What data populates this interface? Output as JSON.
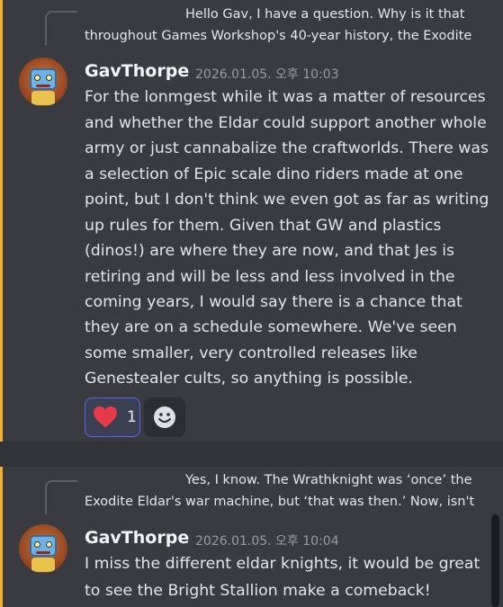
{
  "messages": [
    {
      "reply_preview": {
        "line1": "Hello Gav, I have a question. Why is it that",
        "line2": "throughout Games Workshop's 40-year history, the Exodite"
      },
      "author": "GavThorpe",
      "timestamp": "2026.01.05. 오후 10:03",
      "lines": [
        "For the lonmgest while it was a matter of resources",
        "and whether the Eldar could support another whole",
        "army or just cannabalize the craftworlds. There was",
        "a selection of Epic scale dino riders made at one",
        "point, but I don't think we even got as far as writing",
        "up rules for them. Given that GW and plastics",
        "(dinos!) are where they are now, and that Jes is",
        "retiring and will be less and less involved in the",
        "coming years, I would say there is a chance that",
        "they are on a schedule somewhere. We've seen",
        "some smaller, very controlled releases like",
        "Genestealer cults, so anything is possible."
      ],
      "reaction": {
        "emoji": "heart-icon",
        "count": "1"
      }
    },
    {
      "reply_preview": {
        "line1": "Yes, I know. The Wrathknight was ‘once’ the",
        "line2": "Exodite Eldar's war machine, but ‘that was then.’ Now, isn't"
      },
      "author": "GavThorpe",
      "timestamp": "2026.01.05. 오후 10:04",
      "lines": [
        "I miss the different eldar knights, it would be great",
        "to see the Bright Stallion make a comeback!"
      ]
    }
  ],
  "colors": {
    "highlight_bar": "#f0b232",
    "reaction_border": "#5865f2",
    "heart": "#e8394a"
  }
}
